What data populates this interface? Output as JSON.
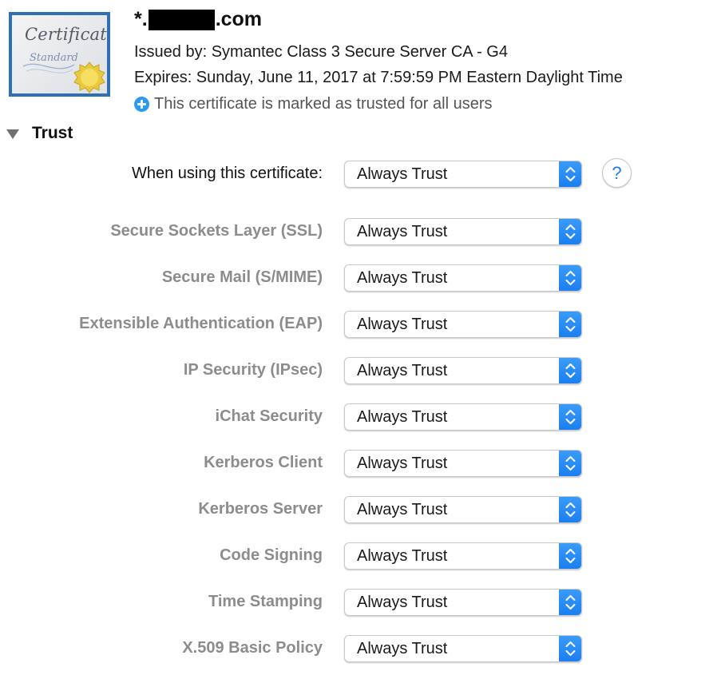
{
  "certificate": {
    "thumbnail_title": "Certificate",
    "thumbnail_subtitle": "Standard",
    "name_prefix": "*.",
    "name_suffix": ".com",
    "issued_by": "Issued by: Symantec Class 3 Secure Server CA - G4",
    "expires": "Expires: Sunday, June 11, 2017 at 7:59:59 PM Eastern Daylight Time",
    "trust_status": "This certificate is marked as trusted for all users"
  },
  "trust": {
    "heading": "Trust",
    "expanded": true,
    "primary": {
      "label": "When using this certificate:",
      "value": "Always Trust"
    },
    "help_label": "?",
    "policies": [
      {
        "label": "Secure Sockets Layer (SSL)",
        "value": "Always Trust"
      },
      {
        "label": "Secure Mail (S/MIME)",
        "value": "Always Trust"
      },
      {
        "label": "Extensible Authentication (EAP)",
        "value": "Always Trust"
      },
      {
        "label": "IP Security (IPsec)",
        "value": "Always Trust"
      },
      {
        "label": "iChat Security",
        "value": "Always Trust"
      },
      {
        "label": "Kerberos Client",
        "value": "Always Trust"
      },
      {
        "label": "Kerberos Server",
        "value": "Always Trust"
      },
      {
        "label": "Code Signing",
        "value": "Always Trust"
      },
      {
        "label": "Time Stamping",
        "value": "Always Trust"
      },
      {
        "label": "X.509 Basic Policy",
        "value": "Always Trust"
      }
    ]
  },
  "colors": {
    "accent_blue": "#1f7cf2",
    "thumbnail_border": "#2f6fb6",
    "disabled_label": "#8c8c8c"
  }
}
